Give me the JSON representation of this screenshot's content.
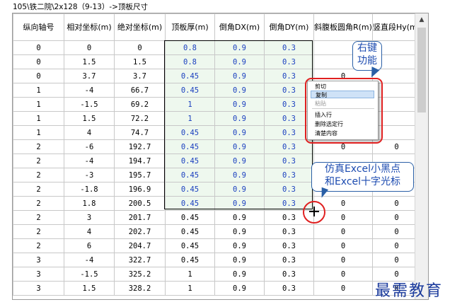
{
  "title": "105\\铁二院\\2x128（9-13）->顶板尺寸",
  "columns": [
    "纵向轴号",
    "相对坐标(m)",
    "绝对坐标(m)",
    "顶板厚(m)",
    "倒角DX(m)",
    "倒角DY(m)",
    "斜腹板圆角R(m)",
    "竖直段Hy(m)"
  ],
  "rows": [
    [
      "0",
      "0",
      "0",
      "0.8",
      "0.9",
      "0.3",
      "",
      ""
    ],
    [
      "0",
      "1.5",
      "1.5",
      "0.8",
      "0.9",
      "0.3",
      "",
      ""
    ],
    [
      "0",
      "3.7",
      "3.7",
      "0.45",
      "0.9",
      "0.3",
      "0",
      ""
    ],
    [
      "1",
      "-4",
      "66.7",
      "0.45",
      "0.9",
      "0.3",
      "",
      ""
    ],
    [
      "1",
      "-1.5",
      "69.2",
      "1",
      "0.9",
      "0.3",
      "",
      ""
    ],
    [
      "1",
      "1.5",
      "72.2",
      "1",
      "0.9",
      "0.3",
      "",
      ""
    ],
    [
      "1",
      "4",
      "74.7",
      "0.45",
      "0.9",
      "0.3",
      "",
      ""
    ],
    [
      "2",
      "-6",
      "192.7",
      "0.45",
      "0.9",
      "0.3",
      "0",
      "0"
    ],
    [
      "2",
      "-4",
      "194.7",
      "0.45",
      "0.9",
      "0.3",
      "",
      ""
    ],
    [
      "2",
      "-3",
      "195.7",
      "0.45",
      "0.9",
      "0.3",
      "",
      ""
    ],
    [
      "2",
      "-1.8",
      "196.9",
      "0.45",
      "0.9",
      "0.3",
      "",
      ""
    ],
    [
      "2",
      "1.8",
      "200.5",
      "0.45",
      "0.9",
      "0.3",
      "0",
      "0"
    ],
    [
      "2",
      "3",
      "201.7",
      "0.45",
      "0.9",
      "0.3",
      "0",
      "0"
    ],
    [
      "2",
      "4",
      "202.7",
      "0.45",
      "0.9",
      "0.3",
      "0",
      "0"
    ],
    [
      "2",
      "6",
      "204.7",
      "0.45",
      "0.9",
      "0.3",
      "0",
      "0"
    ],
    [
      "3",
      "-4",
      "322.7",
      "0.45",
      "0.9",
      "0.3",
      "0",
      "0"
    ],
    [
      "3",
      "-1.5",
      "325.2",
      "1",
      "0.9",
      "0.3",
      "0",
      "0"
    ],
    [
      "3",
      "1.5",
      "328.2",
      "1",
      "0.9",
      "0.3",
      "0",
      "0"
    ]
  ],
  "context_menu": [
    "剪切",
    "复制",
    "粘贴",
    "插入行",
    "删除选定行",
    "清楚内容"
  ],
  "callouts": {
    "right_click": "右键\n功能",
    "excel": "仿真Excel小黑点\n和Excel十字光标"
  },
  "watermark": "最需教育"
}
